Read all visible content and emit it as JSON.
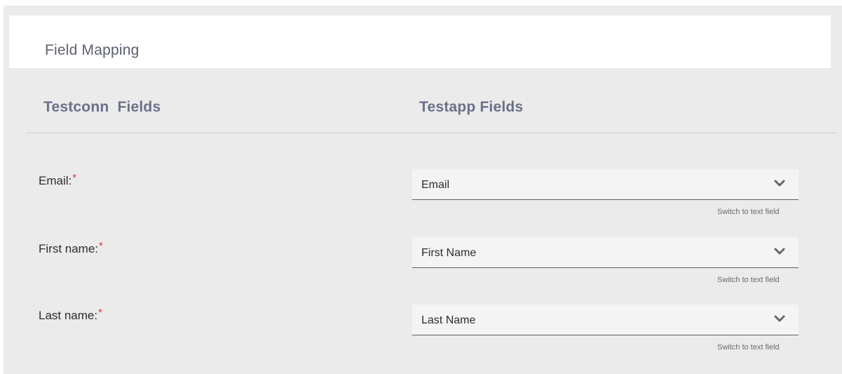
{
  "header": {
    "title": "Field Mapping"
  },
  "columns": {
    "left_title": "Testconn  Fields",
    "right_title": "Testapp Fields"
  },
  "rows": [
    {
      "label": "Email:",
      "required_mark": "*",
      "selected": "Email",
      "switch_label": "Switch to text field"
    },
    {
      "label": "First name:",
      "required_mark": "*",
      "selected": "First Name",
      "switch_label": "Switch to text field"
    },
    {
      "label": "Last name:",
      "required_mark": "*",
      "selected": "Last Name",
      "switch_label": "Switch to text field"
    }
  ],
  "icons": {
    "dropdown": "chevron-down-icon"
  },
  "colors": {
    "panel_bg": "#ebebeb",
    "required": "#e23b3b",
    "header_text": "#6a7189"
  }
}
